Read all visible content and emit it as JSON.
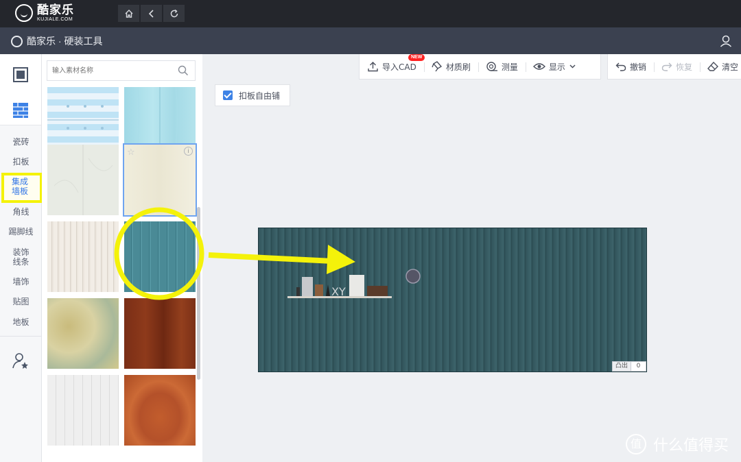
{
  "app": {
    "logo_name": "酷家乐",
    "logo_domain": "KUJIALE.COM",
    "subheader_title": "酷家乐 · 硬装工具"
  },
  "nav": {
    "home_icon": "home-icon",
    "back_icon": "back-icon",
    "refresh_icon": "refresh-icon"
  },
  "sidebar": {
    "categories": [
      {
        "label": "瓷砖",
        "active": false
      },
      {
        "label": "扣板",
        "active": false
      },
      {
        "label": "集成墙板",
        "active": true
      },
      {
        "label": "角线",
        "active": false
      },
      {
        "label": "踢脚线",
        "active": false
      },
      {
        "label": "装饰线条",
        "active": false
      },
      {
        "label": "墙饰",
        "active": false
      },
      {
        "label": "贴图",
        "active": false
      },
      {
        "label": "地板",
        "active": false
      }
    ]
  },
  "panel": {
    "search_placeholder": "输入素材名称",
    "thumbnails": [
      {
        "name": "light-blue-stripe-panel"
      },
      {
        "name": "light-blue-wood-panel"
      },
      {
        "name": "white-marble-panel"
      },
      {
        "name": "cream-wood-panel"
      },
      {
        "name": "cream-vertical-fluted-panel"
      },
      {
        "name": "teal-vertical-fluted-panel"
      },
      {
        "name": "yellow-green-marble-panel"
      },
      {
        "name": "dark-red-wood-panel"
      },
      {
        "name": "white-vertical-panel"
      },
      {
        "name": "orange-wood-grain-panel"
      }
    ]
  },
  "toolbar": {
    "import_cad": "导入CAD",
    "new_badge": "NEW",
    "material_brush": "材质刷",
    "measure": "测量",
    "display": "显示",
    "undo": "撤销",
    "redo": "恢复",
    "clear": "清空"
  },
  "canvas": {
    "free_pave_label": "扣板自由铺",
    "free_pave_checked": true,
    "protrude_label": "凸出",
    "protrude_value": "0",
    "wall_color": "#33565d"
  },
  "watermark": {
    "text": "什么值得买",
    "icon": "值"
  },
  "colors": {
    "accent": "#3d82e6",
    "highlight": "#f4f20a",
    "header": "#24262c",
    "subheader": "#3b4150"
  }
}
